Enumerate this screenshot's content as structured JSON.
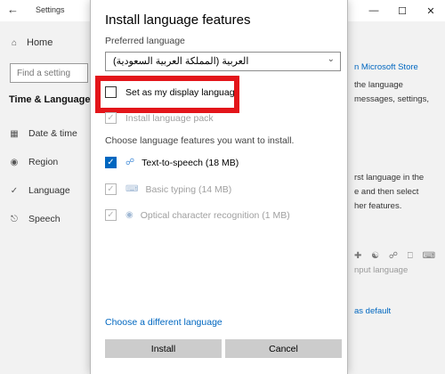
{
  "settings_window": {
    "title": "Settings",
    "back_icon": "back-arrow-icon",
    "controls": [
      "—",
      "☐",
      "✕"
    ],
    "sidebar": {
      "home": "Home",
      "search_placeholder": "Find a setting",
      "section": "Time & Language",
      "items": [
        {
          "label": "Date & time",
          "icon": "calendar-icon"
        },
        {
          "label": "Region",
          "icon": "globe-icon"
        },
        {
          "label": "Language",
          "icon": "language-icon"
        },
        {
          "label": "Speech",
          "icon": "microphone-icon"
        }
      ]
    },
    "right_panel": {
      "store_link": "n Microsoft Store",
      "text1": [
        "the language",
        "messages, settings,"
      ],
      "text2": [
        "rst language in the",
        "e and then select",
        "her features."
      ],
      "input_language": "nput language",
      "default_link": "as default"
    }
  },
  "dialog": {
    "title": "Install language features",
    "preferred_label": "Preferred language",
    "preferred_value": "العربية (المملكة العربية السعودية)",
    "display_language_label": "Set as my display language",
    "install_pack_label": "Install language pack",
    "choose_features_label": "Choose language features you want to install.",
    "features": [
      {
        "label": "Text-to-speech (18 MB)",
        "checked": true,
        "enabled": true,
        "icon": "speech-icon"
      },
      {
        "label": "Basic typing (14 MB)",
        "checked": true,
        "enabled": false,
        "icon": "keyboard-icon"
      },
      {
        "label": "Optical character recognition (1 MB)",
        "checked": true,
        "enabled": false,
        "icon": "ocr-icon"
      }
    ],
    "different_language_link": "Choose a different language",
    "install_button": "Install",
    "cancel_button": "Cancel"
  },
  "colors": {
    "accent": "#0067c0",
    "highlight_box": "#e3151a"
  }
}
